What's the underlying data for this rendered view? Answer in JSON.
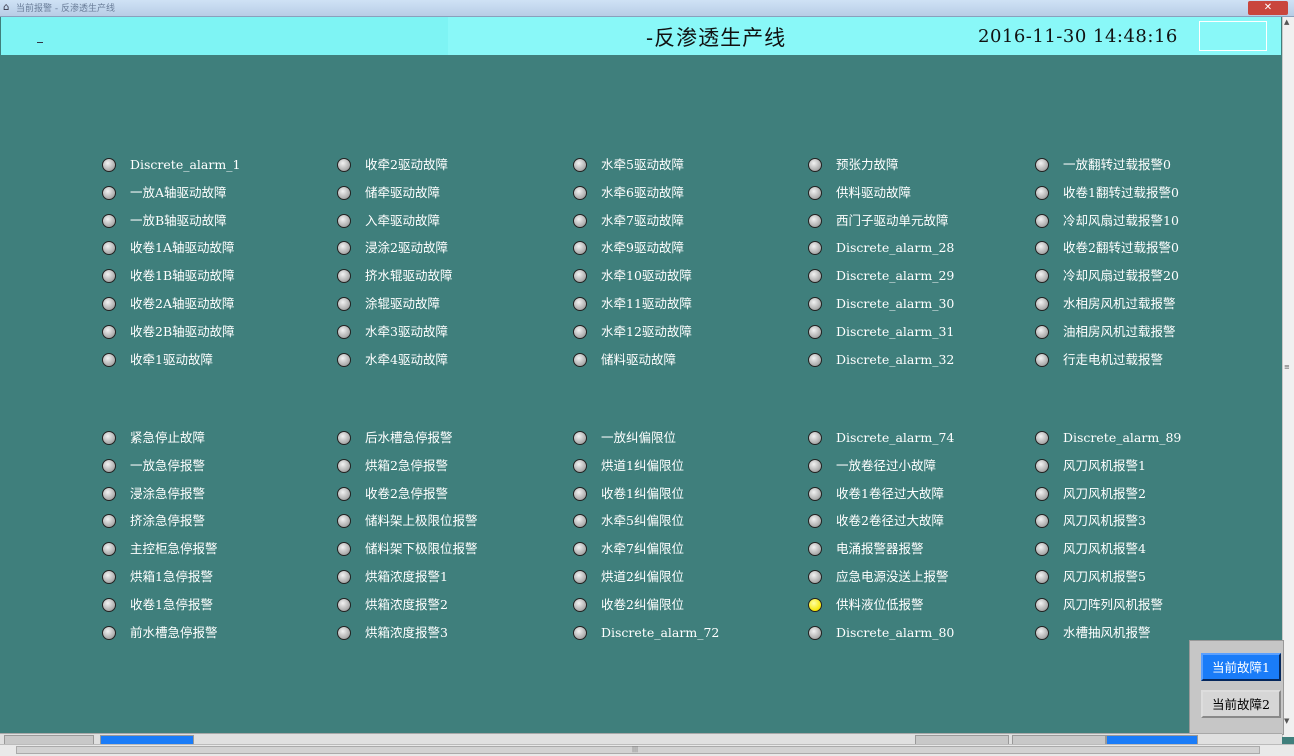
{
  "window": {
    "title": "当前报警 - 反渗透生产线",
    "close_label": "✕"
  },
  "header": {
    "title": "-反渗透生产线",
    "datetime": "2016-11-30 14:48:16"
  },
  "colors": {
    "background": "#3f7f7c",
    "header": "#89f8f8",
    "led_off": "#b5b5b5",
    "led_on": "#f5e400",
    "active_button": "#1a7cf8"
  },
  "alarms": {
    "group1": [
      [
        "Discrete_alarm_1",
        "一放A轴驱动故障",
        "一放B轴驱动故障",
        "收卷1A轴驱动故障",
        "收卷1B轴驱动故障",
        "收卷2A轴驱动故障",
        "收卷2B轴驱动故障",
        "收牵1驱动故障"
      ],
      [
        "收牵2驱动故障",
        "储牵驱动故障",
        "入牵驱动故障",
        "浸涂2驱动故障",
        "挤水辊驱动故障",
        "涂辊驱动故障",
        "水牵3驱动故障",
        "水牵4驱动故障"
      ],
      [
        "水牵5驱动故障",
        "水牵6驱动故障",
        "水牵7驱动故障",
        "水牵9驱动故障",
        "水牵10驱动故障",
        "水牵11驱动故障",
        "水牵12驱动故障",
        "储料驱动故障"
      ],
      [
        "预张力故障",
        "供料驱动故障",
        "西门子驱动单元故障",
        "Discrete_alarm_28",
        "Discrete_alarm_29",
        "Discrete_alarm_30",
        "Discrete_alarm_31",
        "Discrete_alarm_32"
      ],
      [
        "一放翻转过载报警0",
        "收卷1翻转过载报警0",
        "冷却风扇过载报警10",
        "收卷2翻转过载报警0",
        "冷却风扇过载报警20",
        "水相房风机过载报警",
        "油相房风机过载报警",
        "行走电机过载报警"
      ]
    ],
    "group2": [
      [
        "紧急停止故障",
        "一放急停报警",
        "浸涂急停报警",
        "挤涂急停报警",
        "主控柜急停报警",
        "烘箱1急停报警",
        "收卷1急停报警",
        "前水槽急停报警"
      ],
      [
        "后水槽急停报警",
        "烘箱2急停报警",
        "收卷2急停报警",
        "储料架上极限位报警",
        "储料架下极限位报警",
        "烘箱浓度报警1",
        "烘箱浓度报警2",
        "烘箱浓度报警3"
      ],
      [
        "一放纠偏限位",
        "烘道1纠偏限位",
        "收卷1纠偏限位",
        "水牵5纠偏限位",
        "水牵7纠偏限位",
        "烘道2纠偏限位",
        "收卷2纠偏限位",
        "Discrete_alarm_72"
      ],
      [
        "Discrete_alarm_74",
        "一放卷径过小故障",
        "收卷1卷径过大故障",
        "收卷2卷径过大故障",
        "电涌报警器报警",
        "应急电源没送上报警",
        "供料液位低报警",
        "Discrete_alarm_80"
      ],
      [
        "Discrete_alarm_89",
        "风刀风机报警1",
        "风刀风机报警2",
        "风刀风机报警3",
        "风刀风机报警4",
        "风刀风机报警5",
        "风刀阵列风机报警",
        "水槽抽风机报警"
      ]
    ],
    "active": [
      "group2.3.6"
    ]
  },
  "buttons": {
    "fault1": "当前故障1",
    "fault2": "当前故障2"
  }
}
